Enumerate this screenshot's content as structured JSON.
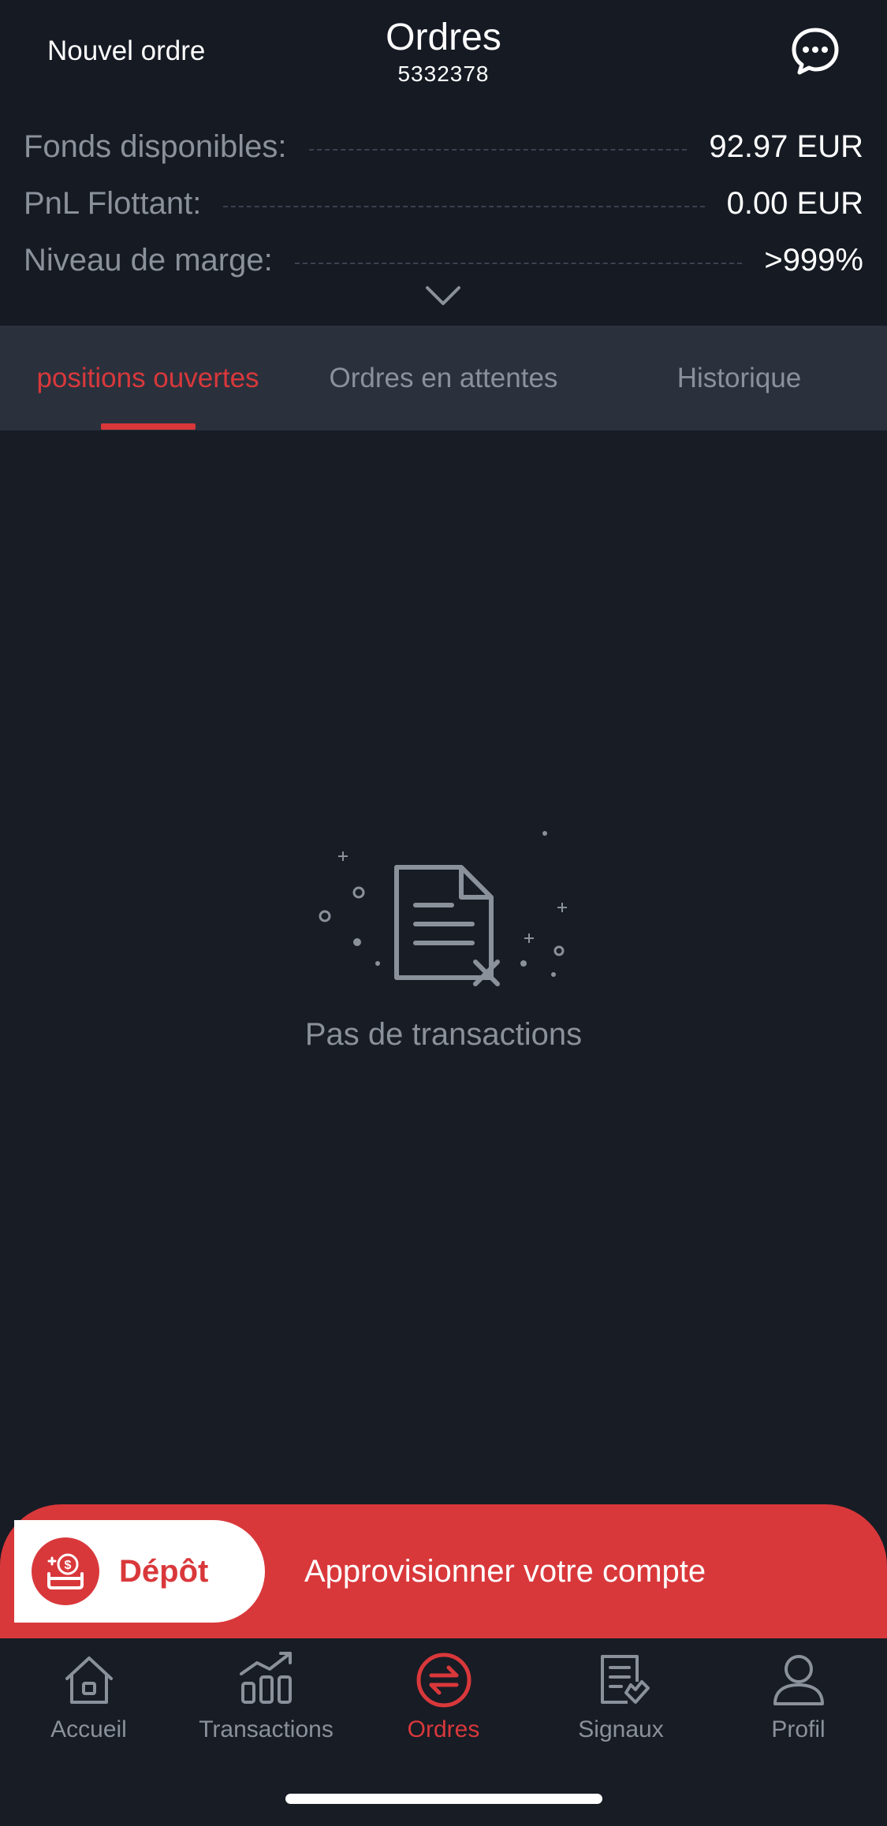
{
  "header": {
    "new_order_label": "Nouvel ordre",
    "title": "Ordres",
    "account_number": "5332378",
    "chat_icon": "chat-bubble-icon"
  },
  "stats": [
    {
      "label": "Fonds disponibles:",
      "value": "92.97 EUR"
    },
    {
      "label": "PnL Flottant:",
      "value": "0.00 EUR"
    },
    {
      "label": "Niveau de marge:",
      "value": ">999%"
    }
  ],
  "tabs": [
    {
      "label": "positions ouvertes",
      "active": true
    },
    {
      "label": "Ordres en attentes",
      "active": false
    },
    {
      "label": "Historique",
      "active": false
    }
  ],
  "empty_state": {
    "icon": "empty-document-icon",
    "text": "Pas de transactions"
  },
  "promo": {
    "deposit_label": "Dépôt",
    "text": "Approvisionner votre compte"
  },
  "tabbar": [
    {
      "label": "Accueil",
      "icon": "home-icon",
      "active": false
    },
    {
      "label": "Transactions",
      "icon": "chart-icon",
      "active": false
    },
    {
      "label": "Ordres",
      "icon": "orders-swap-icon",
      "active": true
    },
    {
      "label": "Signaux",
      "icon": "signals-icon",
      "active": false
    },
    {
      "label": "Profil",
      "icon": "profile-icon",
      "active": false
    }
  ],
  "colors": {
    "accent": "#d9383b",
    "background": "#171c25",
    "tabs_background": "#2a313d",
    "muted_text": "#8b919b"
  }
}
